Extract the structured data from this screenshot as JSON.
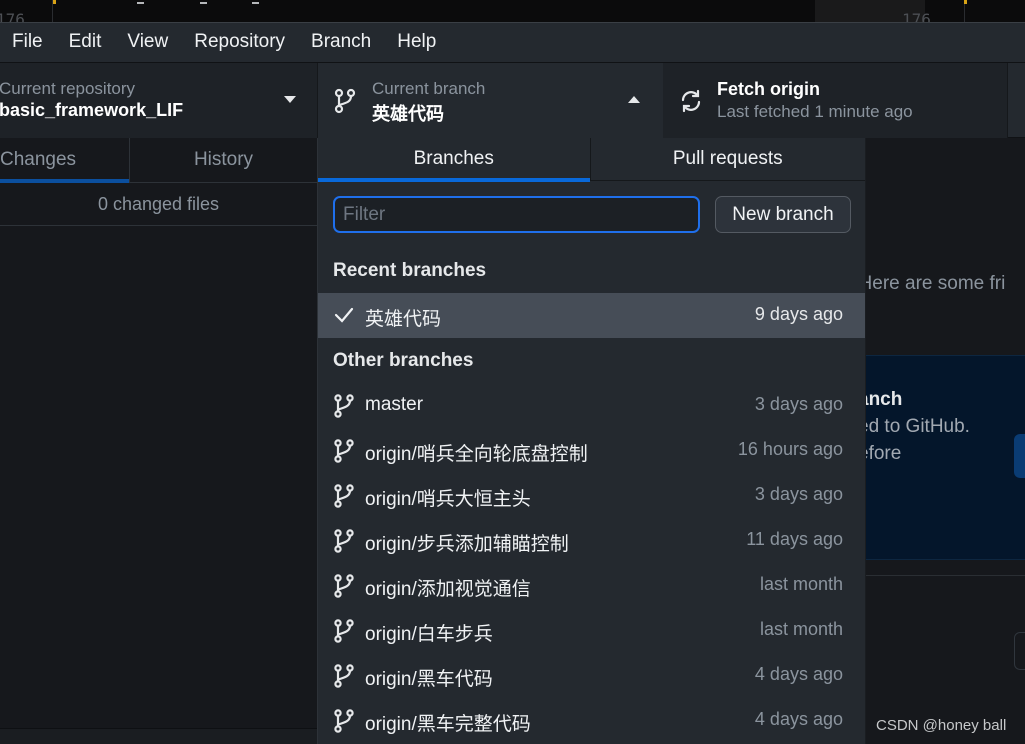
{
  "background_window": {
    "line_number_left": "176",
    "line_number_right": "176"
  },
  "menu": {
    "items": [
      "File",
      "Edit",
      "View",
      "Repository",
      "Branch",
      "Help"
    ]
  },
  "toolbar": {
    "repository": {
      "label": "Current repository",
      "value": "basic_framework_LIF",
      "icon": "chevron-down-icon"
    },
    "branch": {
      "label": "Current branch",
      "value": "英雄代码",
      "icon": "git-branch-icon",
      "caret": "chevron-up-icon"
    },
    "fetch": {
      "title": "Fetch origin",
      "subtitle": "Last fetched 1 minute ago",
      "icon": "sync-icon"
    }
  },
  "sidebar": {
    "tabs": [
      {
        "label": "Changes",
        "active": true
      },
      {
        "label": "History",
        "active": false
      }
    ],
    "changed_files": "0 changed files"
  },
  "main": {
    "intro_text": ". Here are some fri",
    "panel": {
      "title": "anch",
      "line1": "ed to GitHub.",
      "line2": "efore"
    },
    "watermark": "CSDN @honey ball"
  },
  "branch_dropdown": {
    "tabs": [
      {
        "label": "Branches",
        "active": true
      },
      {
        "label": "Pull requests",
        "active": false
      }
    ],
    "filter": {
      "placeholder": "Filter",
      "value": ""
    },
    "new_branch_label": "New branch",
    "recent_heading": "Recent branches",
    "recent_branches": [
      {
        "name": "英雄代码",
        "time": "9 days ago",
        "current": true,
        "icon": "check-icon"
      }
    ],
    "other_heading": "Other branches",
    "other_branches": [
      {
        "name": "master",
        "time": "3 days ago",
        "icon": "git-branch-icon"
      },
      {
        "name": "origin/哨兵全向轮底盘控制",
        "time": "16 hours ago",
        "icon": "git-branch-icon"
      },
      {
        "name": "origin/哨兵大恒主头",
        "time": "3 days ago",
        "icon": "git-branch-icon"
      },
      {
        "name": "origin/步兵添加辅瞄控制",
        "time": "11 days ago",
        "icon": "git-branch-icon"
      },
      {
        "name": "origin/添加视觉通信",
        "time": "last month",
        "icon": "git-branch-icon"
      },
      {
        "name": "origin/白车步兵",
        "time": "last month",
        "icon": "git-branch-icon"
      },
      {
        "name": "origin/黑车代码",
        "time": "4 days ago",
        "icon": "git-branch-icon"
      },
      {
        "name": "origin/黑车完整代码",
        "time": "4 days ago",
        "icon": "git-branch-icon"
      }
    ]
  },
  "colors": {
    "accent": "#0969da",
    "selected_row": "#464d57",
    "toolbar_bg": "#24292f",
    "app_bg": "#16181c"
  }
}
